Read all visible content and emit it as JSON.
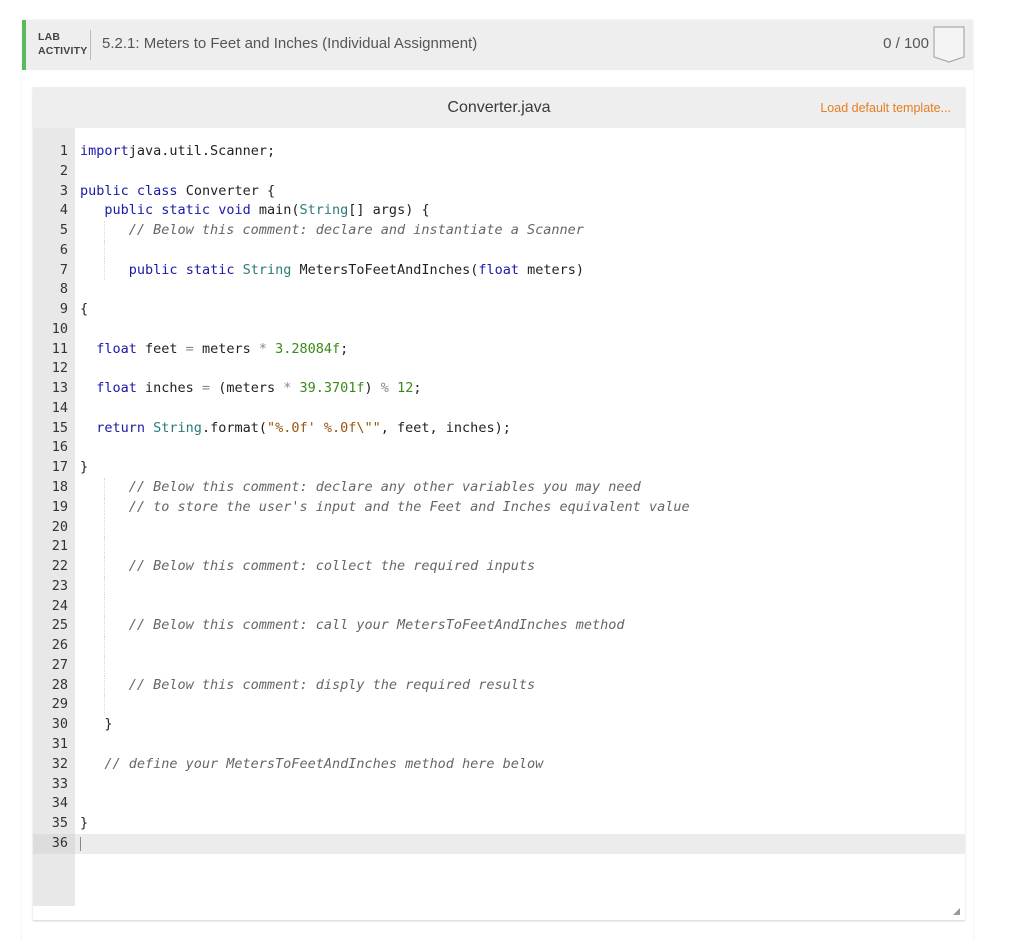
{
  "activity": {
    "type_line1": "LAB",
    "type_line2": "ACTIVITY",
    "title": "5.2.1: Meters to Feet and Inches (Individual Assignment)",
    "score": "0 / 100",
    "accent_color": "#5cb85c"
  },
  "editor": {
    "filename": "Converter.java",
    "load_template_label": "Load default template...",
    "active_line": 36,
    "lines": [
      {
        "n": "1",
        "indent": 0,
        "tokens": [
          [
            "kw",
            "import"
          ],
          [
            "",
            "java.util.Scanner;"
          ]
        ]
      },
      {
        "n": "2",
        "indent": 0,
        "tokens": []
      },
      {
        "n": "3",
        "indent": 0,
        "tokens": [
          [
            "kw",
            "public"
          ],
          [
            "",
            " "
          ],
          [
            "kw",
            "class"
          ],
          [
            "",
            " Converter {"
          ]
        ]
      },
      {
        "n": "4",
        "indent": 3,
        "tokens": [
          [
            "kw",
            "public"
          ],
          [
            "",
            " "
          ],
          [
            "kw",
            "static"
          ],
          [
            "",
            " "
          ],
          [
            "kw",
            "void"
          ],
          [
            "",
            " main("
          ],
          [
            "ty",
            "String"
          ],
          [
            "",
            "[] args) {"
          ]
        ]
      },
      {
        "n": "5",
        "indent": 6,
        "guides": [
          3
        ],
        "tokens": [
          [
            "cm",
            "// Below this comment: declare and instantiate a Scanner"
          ]
        ]
      },
      {
        "n": "6",
        "indent": 0,
        "guides": [
          3
        ],
        "tokens": []
      },
      {
        "n": "7",
        "indent": 6,
        "guides": [
          3
        ],
        "tokens": [
          [
            "kw",
            "public"
          ],
          [
            "",
            " "
          ],
          [
            "kw",
            "static"
          ],
          [
            "",
            " "
          ],
          [
            "ty",
            "String"
          ],
          [
            "",
            " MetersToFeetAndInches("
          ],
          [
            "kw",
            "float"
          ],
          [
            "",
            " meters)"
          ]
        ]
      },
      {
        "n": "8",
        "indent": 0,
        "tokens": []
      },
      {
        "n": "9",
        "indent": 0,
        "tokens": [
          [
            "",
            "{"
          ]
        ]
      },
      {
        "n": "10",
        "indent": 0,
        "tokens": []
      },
      {
        "n": "11",
        "indent": 2,
        "tokens": [
          [
            "kw",
            "float"
          ],
          [
            "",
            " feet "
          ],
          [
            "op",
            "="
          ],
          [
            "",
            " meters "
          ],
          [
            "op",
            "*"
          ],
          [
            "",
            " "
          ],
          [
            "num",
            "3.28084f"
          ],
          [
            "",
            ";"
          ]
        ]
      },
      {
        "n": "12",
        "indent": 0,
        "tokens": []
      },
      {
        "n": "13",
        "indent": 2,
        "tokens": [
          [
            "kw",
            "float"
          ],
          [
            "",
            " inches "
          ],
          [
            "op",
            "="
          ],
          [
            "",
            " (meters "
          ],
          [
            "op",
            "*"
          ],
          [
            "",
            " "
          ],
          [
            "num",
            "39.3701f"
          ],
          [
            "",
            ") "
          ],
          [
            "op",
            "%"
          ],
          [
            "",
            " "
          ],
          [
            "num",
            "12"
          ],
          [
            "",
            ";"
          ]
        ]
      },
      {
        "n": "14",
        "indent": 0,
        "tokens": []
      },
      {
        "n": "15",
        "indent": 2,
        "tokens": [
          [
            "kw",
            "return"
          ],
          [
            "",
            " "
          ],
          [
            "ty",
            "String"
          ],
          [
            "",
            ".format("
          ],
          [
            "str",
            "\"%.0f' %.0f\\\"\""
          ],
          [
            "",
            ", feet, inches);"
          ]
        ]
      },
      {
        "n": "16",
        "indent": 0,
        "tokens": []
      },
      {
        "n": "17",
        "indent": 0,
        "tokens": [
          [
            "",
            "}"
          ]
        ]
      },
      {
        "n": "18",
        "indent": 6,
        "guides": [
          3
        ],
        "tokens": [
          [
            "cm",
            "// Below this comment: declare any other variables you may need"
          ]
        ]
      },
      {
        "n": "19",
        "indent": 6,
        "guides": [
          3
        ],
        "tokens": [
          [
            "cm",
            "// to store the user's input and the Feet and Inches equivalent value"
          ]
        ]
      },
      {
        "n": "20",
        "indent": 0,
        "guides": [
          3
        ],
        "tokens": []
      },
      {
        "n": "21",
        "indent": 0,
        "guides": [
          3
        ],
        "tokens": []
      },
      {
        "n": "22",
        "indent": 6,
        "guides": [
          3
        ],
        "tokens": [
          [
            "cm",
            "// Below this comment: collect the required inputs"
          ]
        ]
      },
      {
        "n": "23",
        "indent": 0,
        "guides": [
          3
        ],
        "tokens": []
      },
      {
        "n": "24",
        "indent": 0,
        "guides": [
          3
        ],
        "tokens": []
      },
      {
        "n": "25",
        "indent": 6,
        "guides": [
          3
        ],
        "tokens": [
          [
            "cm",
            "// Below this comment: call your MetersToFeetAndInches method"
          ]
        ]
      },
      {
        "n": "26",
        "indent": 0,
        "guides": [
          3
        ],
        "tokens": []
      },
      {
        "n": "27",
        "indent": 0,
        "guides": [
          3
        ],
        "tokens": []
      },
      {
        "n": "28",
        "indent": 6,
        "guides": [
          3
        ],
        "tokens": [
          [
            "cm",
            "// Below this comment: disply the required results"
          ]
        ]
      },
      {
        "n": "29",
        "indent": 0,
        "guides": [
          3
        ],
        "tokens": []
      },
      {
        "n": "30",
        "indent": 3,
        "tokens": [
          [
            "",
            "}"
          ]
        ]
      },
      {
        "n": "31",
        "indent": 0,
        "tokens": []
      },
      {
        "n": "32",
        "indent": 3,
        "tokens": [
          [
            "cm",
            "// define your MetersToFeetAndInches method here below"
          ]
        ]
      },
      {
        "n": "33",
        "indent": 0,
        "tokens": []
      },
      {
        "n": "34",
        "indent": 0,
        "tokens": []
      },
      {
        "n": "35",
        "indent": 0,
        "tokens": [
          [
            "",
            "}"
          ]
        ]
      },
      {
        "n": "36",
        "indent": 0,
        "tokens": []
      }
    ]
  }
}
